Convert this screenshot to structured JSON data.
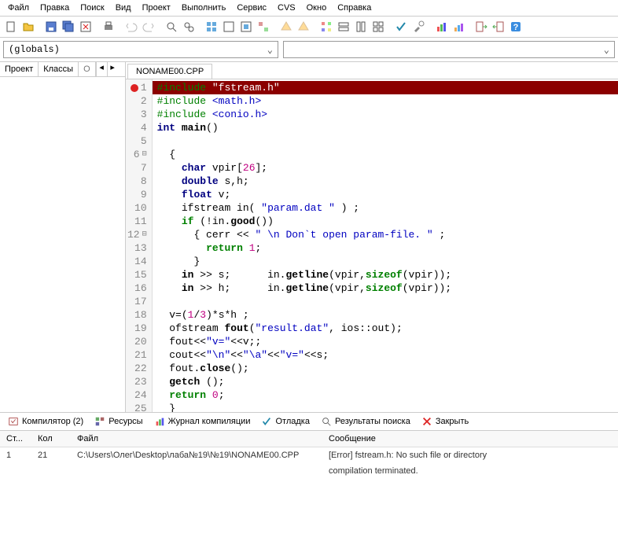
{
  "menubar": [
    "Файл",
    "Правка",
    "Поиск",
    "Вид",
    "Проект",
    "Выполнить",
    "Сервис",
    "CVS",
    "Окно",
    "Справка"
  ],
  "combos": {
    "scope": "(globals)",
    "symbol": ""
  },
  "left_tabs": {
    "project": "Проект",
    "classes": "Классы",
    "other": "О"
  },
  "file_tab": "NONAME00.CPP",
  "code": [
    {
      "n": "1",
      "err": true,
      "tokens": [
        [
          "pp",
          "#include "
        ],
        [
          "s",
          "\"fstream.h\""
        ]
      ]
    },
    {
      "n": "2",
      "tokens": [
        [
          "pp",
          "#include "
        ],
        [
          "s",
          "<math.h>"
        ]
      ]
    },
    {
      "n": "3",
      "tokens": [
        [
          "pp",
          "#include "
        ],
        [
          "s",
          "<conio.h>"
        ]
      ]
    },
    {
      "n": "4",
      "tokens": [
        [
          "ty",
          "int"
        ],
        [
          "op",
          " "
        ],
        [
          "fn",
          "main"
        ],
        [
          "op",
          "()"
        ]
      ]
    },
    {
      "n": "5",
      "tokens": []
    },
    {
      "n": "6",
      "fold": "⊟",
      "tokens": [
        [
          "op",
          "  {"
        ]
      ]
    },
    {
      "n": "7",
      "tokens": [
        [
          "op",
          "    "
        ],
        [
          "ty",
          "char"
        ],
        [
          "op",
          " vpir["
        ],
        [
          "num",
          "26"
        ],
        [
          "op",
          "];"
        ]
      ]
    },
    {
      "n": "8",
      "tokens": [
        [
          "op",
          "    "
        ],
        [
          "ty",
          "double"
        ],
        [
          "op",
          " s,h;"
        ]
      ]
    },
    {
      "n": "9",
      "tokens": [
        [
          "op",
          "    "
        ],
        [
          "ty",
          "float"
        ],
        [
          "op",
          " v;"
        ]
      ]
    },
    {
      "n": "10",
      "tokens": [
        [
          "op",
          "    ifstream in( "
        ],
        [
          "s",
          "\"param.dat \""
        ],
        [
          "op",
          " ) ;"
        ]
      ]
    },
    {
      "n": "11",
      "tokens": [
        [
          "op",
          "    "
        ],
        [
          "kw",
          "if"
        ],
        [
          "op",
          " (!in."
        ],
        [
          "fn",
          "good"
        ],
        [
          "op",
          "())"
        ]
      ]
    },
    {
      "n": "12",
      "fold": "⊟",
      "tokens": [
        [
          "op",
          "      { cerr << "
        ],
        [
          "s",
          "\" \\n Don`t open param-file. \""
        ],
        [
          "op",
          " ;"
        ]
      ]
    },
    {
      "n": "13",
      "tokens": [
        [
          "op",
          "        "
        ],
        [
          "kw",
          "return"
        ],
        [
          "op",
          " "
        ],
        [
          "num",
          "1"
        ],
        [
          "op",
          ";"
        ]
      ]
    },
    {
      "n": "14",
      "tokens": [
        [
          "op",
          "      }"
        ]
      ]
    },
    {
      "n": "15",
      "tokens": [
        [
          "op",
          "    "
        ],
        [
          "fn",
          "in"
        ],
        [
          "op",
          " >> s;      in."
        ],
        [
          "fn",
          "getline"
        ],
        [
          "op",
          "(vpir,"
        ],
        [
          "kw",
          "sizeof"
        ],
        [
          "op",
          "(vpir));"
        ]
      ]
    },
    {
      "n": "16",
      "tokens": [
        [
          "op",
          "    "
        ],
        [
          "fn",
          "in"
        ],
        [
          "op",
          " >> h;      in."
        ],
        [
          "fn",
          "getline"
        ],
        [
          "op",
          "(vpir,"
        ],
        [
          "kw",
          "sizeof"
        ],
        [
          "op",
          "(vpir));"
        ]
      ]
    },
    {
      "n": "17",
      "tokens": []
    },
    {
      "n": "18",
      "tokens": [
        [
          "op",
          "  v=("
        ],
        [
          "num",
          "1"
        ],
        [
          "op",
          "/"
        ],
        [
          "num",
          "3"
        ],
        [
          "op",
          ")*s*h ;"
        ]
      ]
    },
    {
      "n": "19",
      "tokens": [
        [
          "op",
          "  ofstream "
        ],
        [
          "fn",
          "fout"
        ],
        [
          "op",
          "("
        ],
        [
          "s",
          "\"result.dat\""
        ],
        [
          "op",
          ", ios::out);"
        ]
      ]
    },
    {
      "n": "20",
      "tokens": [
        [
          "op",
          "  fout<<"
        ],
        [
          "s",
          "\"v=\""
        ],
        [
          "op",
          "<<v;;"
        ]
      ]
    },
    {
      "n": "21",
      "tokens": [
        [
          "op",
          "  cout<<"
        ],
        [
          "s",
          "\"\\n\""
        ],
        [
          "op",
          "<<"
        ],
        [
          "s",
          "\"\\a\""
        ],
        [
          "op",
          "<<"
        ],
        [
          "s",
          "\"v=\""
        ],
        [
          "op",
          "<<s;"
        ]
      ]
    },
    {
      "n": "22",
      "tokens": [
        [
          "op",
          "  fout."
        ],
        [
          "fn",
          "close"
        ],
        [
          "op",
          "();"
        ]
      ]
    },
    {
      "n": "23",
      "tokens": [
        [
          "op",
          "  "
        ],
        [
          "fn",
          "getch"
        ],
        [
          "op",
          " ();"
        ]
      ]
    },
    {
      "n": "24",
      "tokens": [
        [
          "op",
          "  "
        ],
        [
          "kw",
          "return"
        ],
        [
          "op",
          " "
        ],
        [
          "num",
          "0"
        ],
        [
          "op",
          ";"
        ]
      ]
    },
    {
      "n": "25",
      "tokens": [
        [
          "op",
          "  }"
        ]
      ]
    }
  ],
  "bottom_tabs": {
    "compiler": "Компилятор (2)",
    "resources": "Ресурсы",
    "log": "Журнал компиляции",
    "debug": "Отладка",
    "find": "Результаты поиска",
    "close": "Закрыть"
  },
  "out_headers": {
    "line": "Ст...",
    "col": "Кол",
    "file": "Файл",
    "msg": "Сообщение"
  },
  "out_rows": [
    {
      "line": "1",
      "col": "21",
      "file": "C:\\Users\\Олег\\Desktop\\лаба№19\\№19\\NONAME00.CPP",
      "msg": "[Error] fstream.h: No such file or directory"
    },
    {
      "line": "",
      "col": "",
      "file": "",
      "msg": "compilation terminated."
    }
  ]
}
